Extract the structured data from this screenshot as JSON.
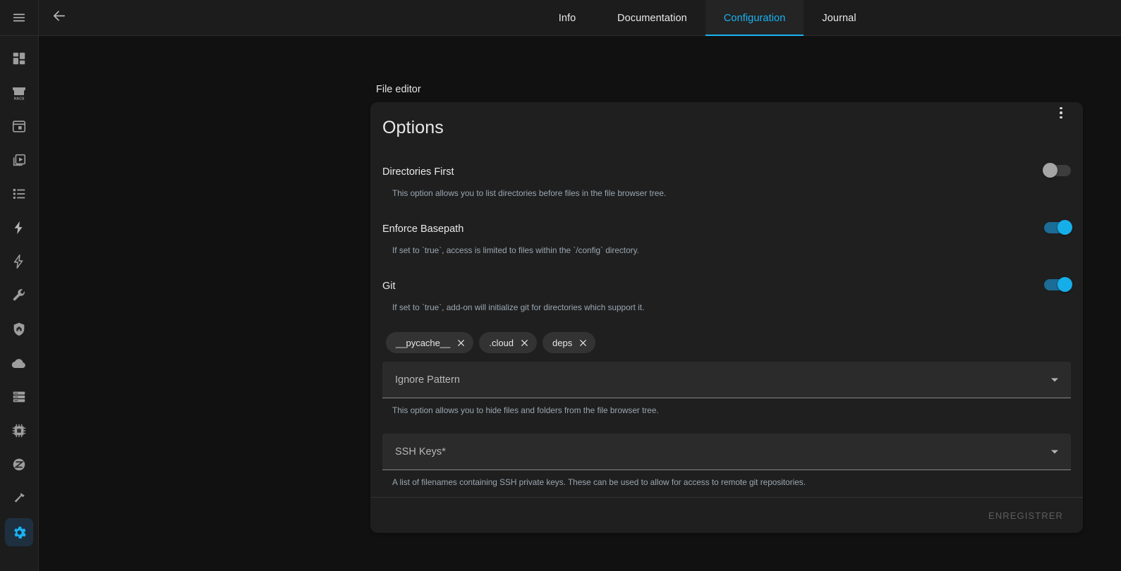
{
  "rail": {
    "menu_icon": "hamburger-menu-icon",
    "items": [
      {
        "name": "overview",
        "icon": "dashboard-icon",
        "active": false
      },
      {
        "name": "hacs",
        "icon": "hacs-store-icon",
        "label": "HACS",
        "active": false
      },
      {
        "name": "calendar",
        "icon": "calendar-icon",
        "active": false
      },
      {
        "name": "media",
        "icon": "media-player-icon",
        "active": false
      },
      {
        "name": "logbook",
        "icon": "logbook-list-icon",
        "active": false
      },
      {
        "name": "energy",
        "icon": "lightning-bolt-icon",
        "active": false
      },
      {
        "name": "automation",
        "icon": "lightning-bolt-outline-icon",
        "active": false
      },
      {
        "name": "developer-tools",
        "icon": "wrench-icon",
        "active": false
      },
      {
        "name": "home-security",
        "icon": "shield-home-icon",
        "active": false
      },
      {
        "name": "weather",
        "icon": "cloud-icon",
        "active": false
      },
      {
        "name": "server",
        "icon": "server-rack-icon",
        "active": false
      },
      {
        "name": "hardware",
        "icon": "chip-icon",
        "active": false
      },
      {
        "name": "zigbee",
        "icon": "zigbee-icon",
        "active": false
      },
      {
        "name": "terminal-tools",
        "icon": "hammer-icon",
        "active": false
      },
      {
        "name": "settings",
        "icon": "gear-icon",
        "active": true
      }
    ]
  },
  "topbar": {
    "back_icon": "arrow-left-icon",
    "tabs": [
      {
        "label": "Info",
        "active": false
      },
      {
        "label": "Documentation",
        "active": false
      },
      {
        "label": "Configuration",
        "active": true
      },
      {
        "label": "Journal",
        "active": false
      }
    ]
  },
  "page": {
    "breadcrumb": "File editor"
  },
  "card": {
    "title": "Options",
    "kebab_icon": "more-vertical-icon",
    "options": [
      {
        "label": "Directories First",
        "description": "This option allows you to list directories before files in the file browser tree.",
        "toggle_on": false
      },
      {
        "label": "Enforce Basepath",
        "description": "If set to `true`, access is limited to files within the `/config` directory.",
        "toggle_on": true
      },
      {
        "label": "Git",
        "description": "If set to `true`, add-on will initialize git for directories which support it.",
        "toggle_on": true
      }
    ],
    "chips": [
      {
        "label": "__pycache__",
        "remove_icon": "close-icon"
      },
      {
        "label": ".cloud",
        "remove_icon": "close-icon"
      },
      {
        "label": "deps",
        "remove_icon": "close-icon"
      }
    ],
    "fields": [
      {
        "label": "Ignore Pattern",
        "value": "",
        "description": "This option allows you to hide files and folders from the file browser tree.",
        "arrow_icon": "chevron-down-icon"
      },
      {
        "label": "SSH Keys*",
        "value": "",
        "description": "A list of filenames containing SSH private keys. These can be used to allow for access to remote git repositories.",
        "arrow_icon": "chevron-down-icon"
      }
    ],
    "save_label": "ENREGISTRER"
  },
  "colors": {
    "accent": "#19b3f3",
    "background": "#111111",
    "card_background": "#1f1f1f",
    "rail_background": "#1c1c1c",
    "toggle_on": "#16aee8",
    "toggle_off": "#a5a5a5",
    "description_text": "#9aa7b2"
  }
}
